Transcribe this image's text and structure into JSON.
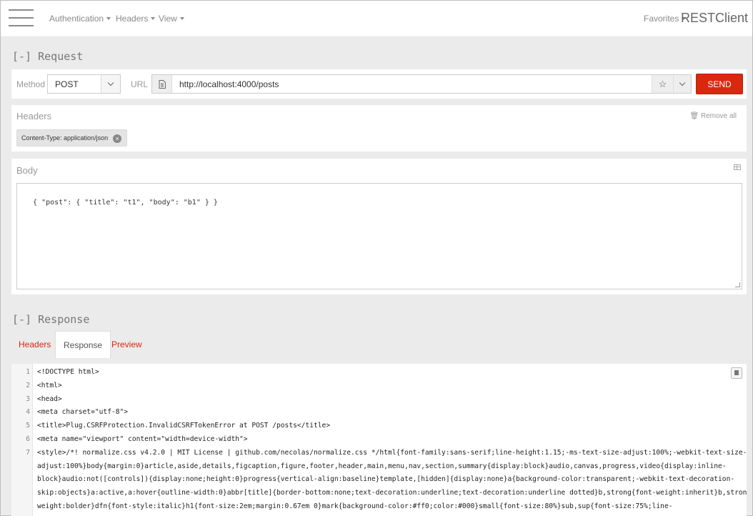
{
  "topbar": {
    "menu_icon": "hamburger-icon",
    "nav": [
      "Authentication",
      "Headers",
      "View"
    ],
    "favorites": "Favorites",
    "brand": "RESTClient"
  },
  "request": {
    "title": "[-] Request",
    "method_label": "Method",
    "method_value": "POST",
    "url_label": "URL",
    "url_value": "http://localhost:4000/posts",
    "send_label": "SEND",
    "accent": "#d9280f"
  },
  "headers": {
    "title": "Headers",
    "remove_all": "Remove all",
    "items": [
      "Content-Type: application/json"
    ]
  },
  "body": {
    "title": "Body",
    "content": "{ \"post\": { \"title\": \"t1\", \"body\": \"b1\" } }"
  },
  "response": {
    "title": "[-] Response",
    "tabs": [
      "Headers",
      "Response",
      "Preview"
    ],
    "active_tab": "Response",
    "lines": [
      {
        "n": "1",
        "text": "<!DOCTYPE html>"
      },
      {
        "n": "2",
        "text": "<html>"
      },
      {
        "n": "3",
        "text": "<head>"
      },
      {
        "n": "4",
        "text": "    <meta charset=\"utf-8\">"
      },
      {
        "n": "5",
        "text": "    <title>Plug.CSRFProtection.InvalidCSRFTokenError at POST /posts</title>"
      },
      {
        "n": "6",
        "text": "    <meta name=\"viewport\" content=\"width=device-width\">"
      },
      {
        "n": "7",
        "text": "    <style>/*! normalize.css v4.2.0 | MIT License | github.com/necolas/normalize.css */html{font-family:sans-serif;line-height:1.15;-ms-text-size-adjust:100%;-webkit-text-size-"
      },
      {
        "n": "",
        "text": "adjust:100%}body{margin:0}article,aside,details,figcaption,figure,footer,header,main,menu,nav,section,summary{display:block}audio,canvas,progress,video{display:inline-"
      },
      {
        "n": "",
        "text": "block}audio:not([controls]){display:none;height:0}progress{vertical-align:baseline}template,[hidden]{display:none}a{background-color:transparent;-webkit-text-decoration-"
      },
      {
        "n": "",
        "text": "skip:objects}a:active,a:hover{outline-width:0}abbr[title]{border-bottom:none;text-decoration:underline;text-decoration:underline dotted}b,strong{font-weight:inherit}b,strong{font-"
      },
      {
        "n": "",
        "text": "weight:bolder}dfn{font-style:italic}h1{font-size:2em;margin:0.67em 0}mark{background-color:#ff0;color:#000}small{font-size:80%}sub,sup{font-size:75%;line-"
      }
    ]
  }
}
